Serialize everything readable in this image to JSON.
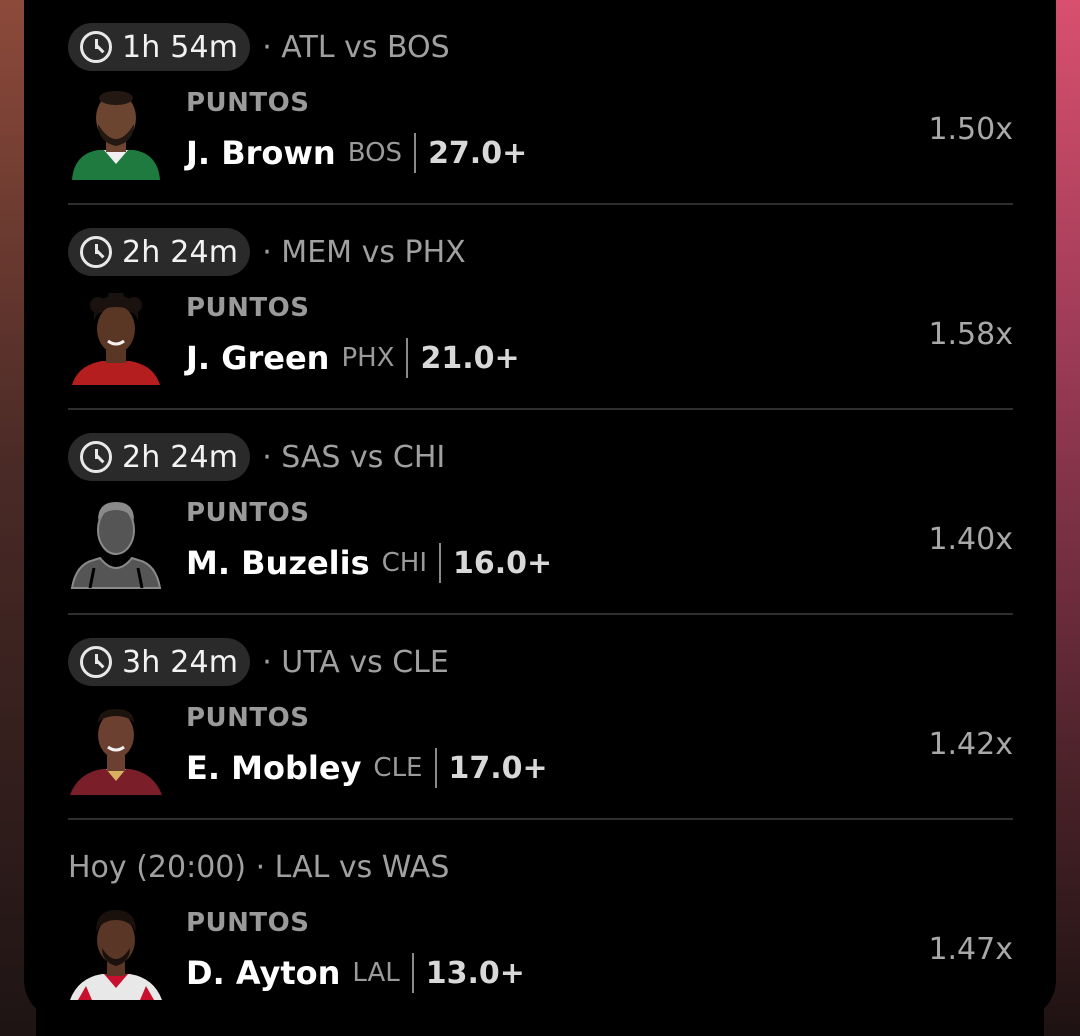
{
  "picks": [
    {
      "time": "1h 54m",
      "matchup": "· ATL vs BOS",
      "stat": "PUNTOS",
      "player": "J. Brown",
      "team": "BOS",
      "line": "27.0+",
      "multiplier": "1.50x",
      "jersey_color": "#1f7a3f",
      "skin": "#6b4530",
      "has_timer": true
    },
    {
      "time": "2h 24m",
      "matchup": "· MEM vs PHX",
      "stat": "PUNTOS",
      "player": "J. Green",
      "team": "PHX",
      "line": "21.0+",
      "multiplier": "1.58x",
      "jersey_color": "#b41e1e",
      "skin": "#5a3625",
      "has_timer": true
    },
    {
      "time": "2h 24m",
      "matchup": "· SAS vs CHI",
      "stat": "PUNTOS",
      "player": "M. Buzelis",
      "team": "CHI",
      "line": "16.0+",
      "multiplier": "1.40x",
      "jersey_color": "#5a5a5a",
      "skin": "#5a5a5a",
      "has_timer": true
    },
    {
      "time": "3h 24m",
      "matchup": "· UTA vs CLE",
      "stat": "PUNTOS",
      "player": "E. Mobley",
      "team": "CLE",
      "line": "17.0+",
      "multiplier": "1.42x",
      "jersey_color": "#7a1f2a",
      "skin": "#6b4030",
      "has_timer": true
    },
    {
      "time": "",
      "matchup": "Hoy (20:00) · LAL vs WAS",
      "stat": "PUNTOS",
      "player": "D. Ayton",
      "team": "LAL",
      "line": "13.0+",
      "multiplier": "1.47x",
      "jersey_color": "#e8e8e8",
      "skin": "#5a3626",
      "has_timer": false
    }
  ]
}
